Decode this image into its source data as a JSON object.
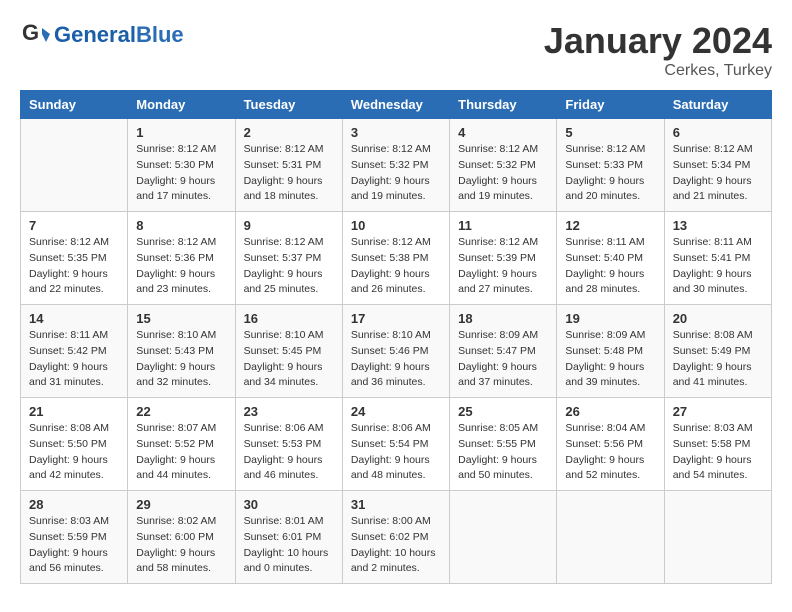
{
  "header": {
    "logo_text_general": "General",
    "logo_text_blue": "Blue",
    "month": "January 2024",
    "location": "Cerkes, Turkey"
  },
  "days_of_week": [
    "Sunday",
    "Monday",
    "Tuesday",
    "Wednesday",
    "Thursday",
    "Friday",
    "Saturday"
  ],
  "weeks": [
    [
      {
        "day": "",
        "info": ""
      },
      {
        "day": "1",
        "info": "Sunrise: 8:12 AM\nSunset: 5:30 PM\nDaylight: 9 hours\nand 17 minutes."
      },
      {
        "day": "2",
        "info": "Sunrise: 8:12 AM\nSunset: 5:31 PM\nDaylight: 9 hours\nand 18 minutes."
      },
      {
        "day": "3",
        "info": "Sunrise: 8:12 AM\nSunset: 5:32 PM\nDaylight: 9 hours\nand 19 minutes."
      },
      {
        "day": "4",
        "info": "Sunrise: 8:12 AM\nSunset: 5:32 PM\nDaylight: 9 hours\nand 19 minutes."
      },
      {
        "day": "5",
        "info": "Sunrise: 8:12 AM\nSunset: 5:33 PM\nDaylight: 9 hours\nand 20 minutes."
      },
      {
        "day": "6",
        "info": "Sunrise: 8:12 AM\nSunset: 5:34 PM\nDaylight: 9 hours\nand 21 minutes."
      }
    ],
    [
      {
        "day": "7",
        "info": ""
      },
      {
        "day": "8",
        "info": "Sunrise: 8:12 AM\nSunset: 5:36 PM\nDaylight: 9 hours\nand 23 minutes."
      },
      {
        "day": "9",
        "info": "Sunrise: 8:12 AM\nSunset: 5:37 PM\nDaylight: 9 hours\nand 25 minutes."
      },
      {
        "day": "10",
        "info": "Sunrise: 8:12 AM\nSunset: 5:38 PM\nDaylight: 9 hours\nand 26 minutes."
      },
      {
        "day": "11",
        "info": "Sunrise: 8:12 AM\nSunset: 5:39 PM\nDaylight: 9 hours\nand 27 minutes."
      },
      {
        "day": "12",
        "info": "Sunrise: 8:11 AM\nSunset: 5:40 PM\nDaylight: 9 hours\nand 28 minutes."
      },
      {
        "day": "13",
        "info": "Sunrise: 8:11 AM\nSunset: 5:41 PM\nDaylight: 9 hours\nand 30 minutes."
      }
    ],
    [
      {
        "day": "14",
        "info": "Sunrise: 8:11 AM\nSunset: 5:42 PM\nDaylight: 9 hours\nand 31 minutes."
      },
      {
        "day": "15",
        "info": "Sunrise: 8:10 AM\nSunset: 5:43 PM\nDaylight: 9 hours\nand 32 minutes."
      },
      {
        "day": "16",
        "info": "Sunrise: 8:10 AM\nSunset: 5:45 PM\nDaylight: 9 hours\nand 34 minutes."
      },
      {
        "day": "17",
        "info": "Sunrise: 8:10 AM\nSunset: 5:46 PM\nDaylight: 9 hours\nand 36 minutes."
      },
      {
        "day": "18",
        "info": "Sunrise: 8:09 AM\nSunset: 5:47 PM\nDaylight: 9 hours\nand 37 minutes."
      },
      {
        "day": "19",
        "info": "Sunrise: 8:09 AM\nSunset: 5:48 PM\nDaylight: 9 hours\nand 39 minutes."
      },
      {
        "day": "20",
        "info": "Sunrise: 8:08 AM\nSunset: 5:49 PM\nDaylight: 9 hours\nand 41 minutes."
      }
    ],
    [
      {
        "day": "21",
        "info": "Sunrise: 8:08 AM\nSunset: 5:50 PM\nDaylight: 9 hours\nand 42 minutes."
      },
      {
        "day": "22",
        "info": "Sunrise: 8:07 AM\nSunset: 5:52 PM\nDaylight: 9 hours\nand 44 minutes."
      },
      {
        "day": "23",
        "info": "Sunrise: 8:06 AM\nSunset: 5:53 PM\nDaylight: 9 hours\nand 46 minutes."
      },
      {
        "day": "24",
        "info": "Sunrise: 8:06 AM\nSunset: 5:54 PM\nDaylight: 9 hours\nand 48 minutes."
      },
      {
        "day": "25",
        "info": "Sunrise: 8:05 AM\nSunset: 5:55 PM\nDaylight: 9 hours\nand 50 minutes."
      },
      {
        "day": "26",
        "info": "Sunrise: 8:04 AM\nSunset: 5:56 PM\nDaylight: 9 hours\nand 52 minutes."
      },
      {
        "day": "27",
        "info": "Sunrise: 8:03 AM\nSunset: 5:58 PM\nDaylight: 9 hours\nand 54 minutes."
      }
    ],
    [
      {
        "day": "28",
        "info": "Sunrise: 8:03 AM\nSunset: 5:59 PM\nDaylight: 9 hours\nand 56 minutes."
      },
      {
        "day": "29",
        "info": "Sunrise: 8:02 AM\nSunset: 6:00 PM\nDaylight: 9 hours\nand 58 minutes."
      },
      {
        "day": "30",
        "info": "Sunrise: 8:01 AM\nSunset: 6:01 PM\nDaylight: 10 hours\nand 0 minutes."
      },
      {
        "day": "31",
        "info": "Sunrise: 8:00 AM\nSunset: 6:02 PM\nDaylight: 10 hours\nand 2 minutes."
      },
      {
        "day": "",
        "info": ""
      },
      {
        "day": "",
        "info": ""
      },
      {
        "day": "",
        "info": ""
      }
    ]
  ]
}
